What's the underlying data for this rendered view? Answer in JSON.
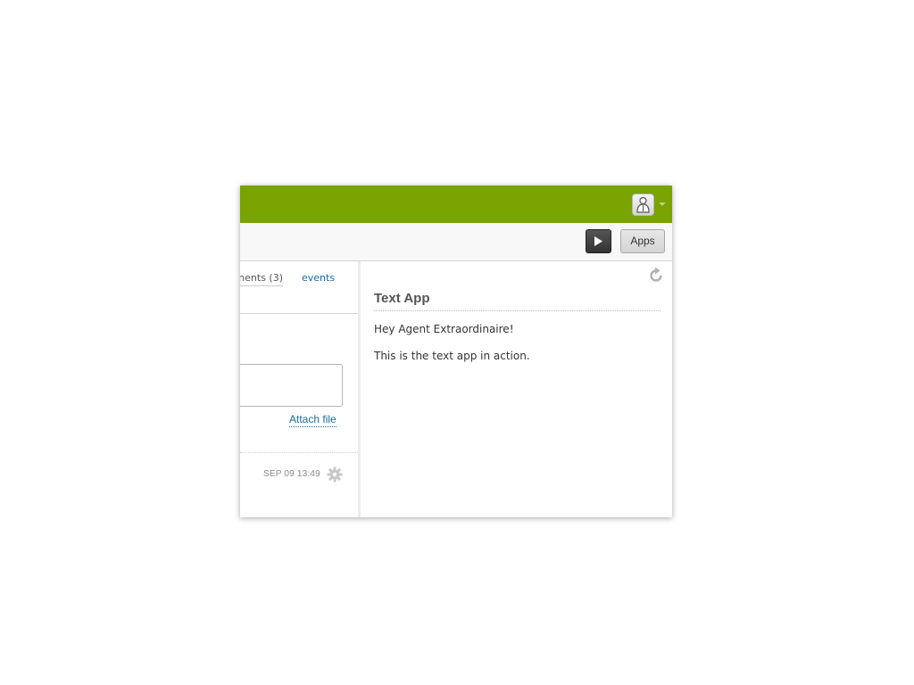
{
  "header": {
    "avatar_icon": "user-avatar-icon",
    "accent_color": "#78a300"
  },
  "toolbar": {
    "play_icon": "play-icon",
    "apps_label": "Apps"
  },
  "ticket": {
    "tabs": [
      {
        "label": "nents (3)"
      },
      {
        "label": "events"
      }
    ],
    "attach_label": "Attach file",
    "comment_timestamp": "SEP 09 13:49",
    "settings_icon": "gear-icon"
  },
  "app_panel": {
    "refresh_icon": "refresh-icon",
    "title": "Text App",
    "lines": [
      "Hey Agent Extraordinaire!",
      "This is the text app in action."
    ]
  }
}
